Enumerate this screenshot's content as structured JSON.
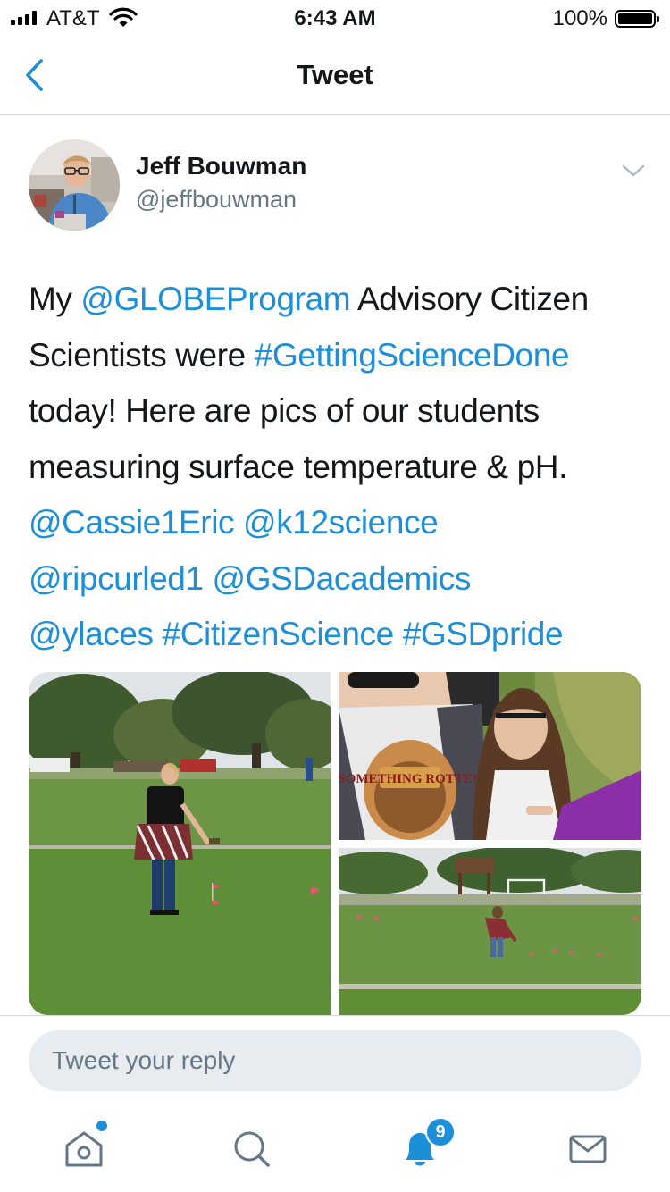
{
  "status_bar": {
    "carrier": "AT&T",
    "time": "6:43 AM",
    "battery": "100%"
  },
  "nav": {
    "title": "Tweet",
    "back_icon": "chevron-left-icon"
  },
  "tweet": {
    "author_name": "Jeff Bouwman",
    "author_handle": "@jeffbouwman",
    "line1_pre": "My ",
    "line1_link": "@GLOBEProgram",
    "line1_post": " Advisory Citizen",
    "line2_pre": "Scientists were ",
    "line2_link": "#GettingScienceDone",
    "line3": "today! Here are pics of our students",
    "line4": "measuring surface temperature & pH.",
    "line5_link1": "@Cassie1Eric",
    "line5_link2": "@k12science",
    "line6_link1": "@ripcurled1",
    "line6_link2": "@GSDacademics",
    "line7_link1": "@ylaces",
    "line7_link2": "#CitizenScience",
    "line7_link3": "#GSDpride"
  },
  "media": {
    "photo2_shirt_text": "SOMETHING ROTTEN"
  },
  "reply": {
    "placeholder": "Tweet your reply"
  },
  "tab_bar": {
    "items": [
      "home-icon",
      "search-icon",
      "bell-icon",
      "mail-icon"
    ],
    "notifications_badge": "9"
  },
  "colors": {
    "accent": "#1d8fd8",
    "text": "#14171a",
    "secondary": "#657786",
    "divider": "#d6d9db",
    "input_bg": "#e6ecf0"
  }
}
